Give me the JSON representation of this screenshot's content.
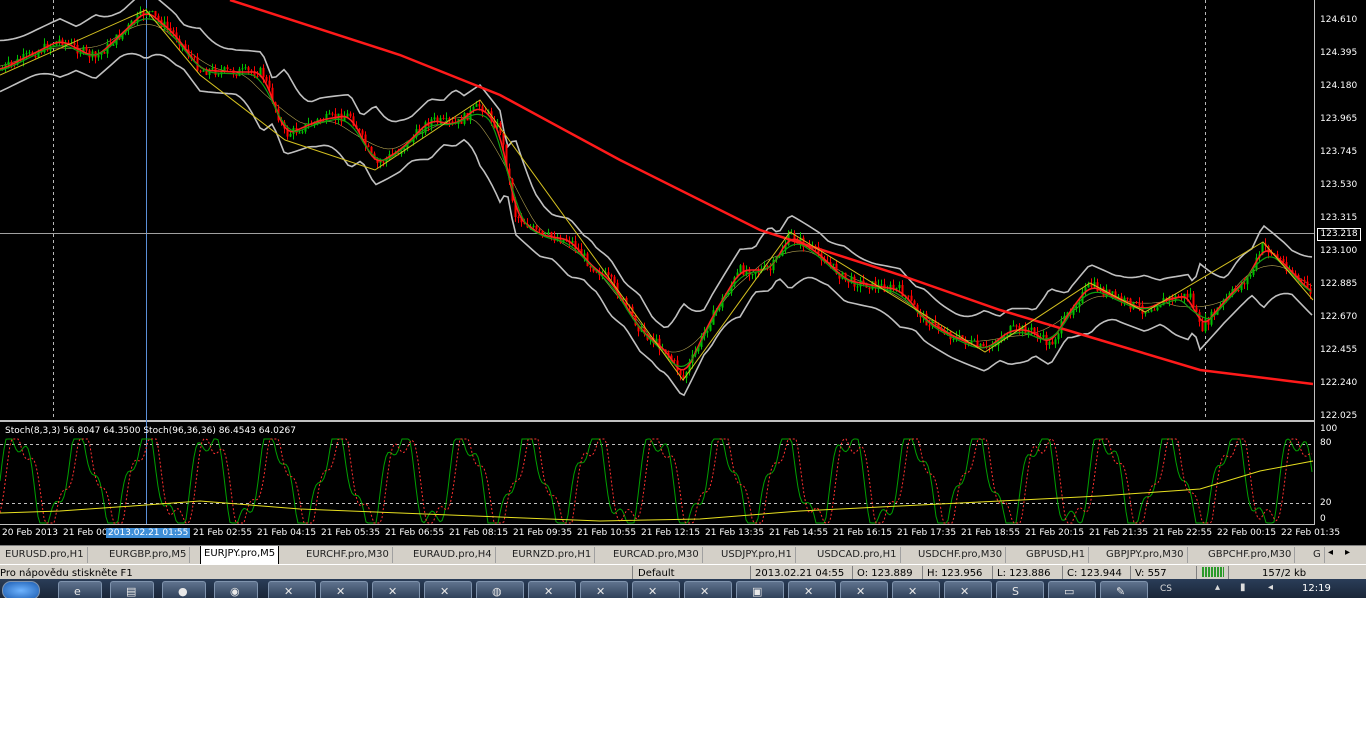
{
  "price_axis": {
    "levels": [
      "124.610",
      "124.395",
      "124.180",
      "123.965",
      "123.745",
      "123.530",
      "123.315",
      "123.100",
      "122.885",
      "122.670",
      "122.455",
      "122.240",
      "122.025"
    ],
    "current_price": "123.218"
  },
  "oscillator": {
    "title": "Stoch(8,3,3) 56.8047 64.3500  Stoch(96,36,36) 86.4543 64.0267",
    "levels": [
      "100",
      "80",
      "20",
      "0"
    ]
  },
  "time_axis": {
    "labels": [
      "20 Feb 2013",
      "21 Feb 00",
      "2013.02.21 01:55",
      "21 Feb 02:55",
      "21 Feb 04:15",
      "21 Feb 05:35",
      "21 Feb 06:55",
      "21 Feb 08:15",
      "21 Feb 09:35",
      "21 Feb 10:55",
      "21 Feb 12:15",
      "21 Feb 13:35",
      "21 Feb 14:55",
      "21 Feb 16:15",
      "21 Feb 17:35",
      "21 Feb 18:55",
      "21 Feb 20:15",
      "21 Feb 21:35",
      "21 Feb 22:55",
      "22 Feb 00:15",
      "22 Feb 01:35"
    ],
    "selected_index": 2
  },
  "tabs": {
    "items": [
      "EURUSD.pro,H1",
      "EURGBP.pro,M5",
      "EURJPY.pro,M5",
      "EURCHF.pro,M30",
      "EURAUD.pro,H4",
      "EURNZD.pro,H1",
      "EURCAD.pro,M30",
      "USDJPY.pro,H1",
      "USDCAD.pro,H1",
      "USDCHF.pro,M30",
      "GBPUSD,H1",
      "GBPJPY.pro,M30",
      "GBPCHF.pro,M30",
      "G"
    ],
    "active_index": 2
  },
  "status": {
    "help": "Pro nápovědu stiskněte F1",
    "profile": "Default",
    "datetime": "2013.02.21 04:55",
    "open": "O: 123.889",
    "high": "H: 123.956",
    "low": "L: 123.886",
    "close": "C: 123.944",
    "volume": "V: 557",
    "traffic": "157/2 kb"
  },
  "taskbar": {
    "clock": "12:19"
  },
  "colors": {
    "background": "#000000",
    "bull_candle": "#00c000",
    "bear_candle": "#ff0000",
    "bollinger": "#c0c0c0",
    "ma_long": "#ff1a1a",
    "zigzag": "#d4c020",
    "stoch_main": "#00a000",
    "stoch_signal": "#ff3030",
    "stoch_slow": "#e8e020"
  }
}
